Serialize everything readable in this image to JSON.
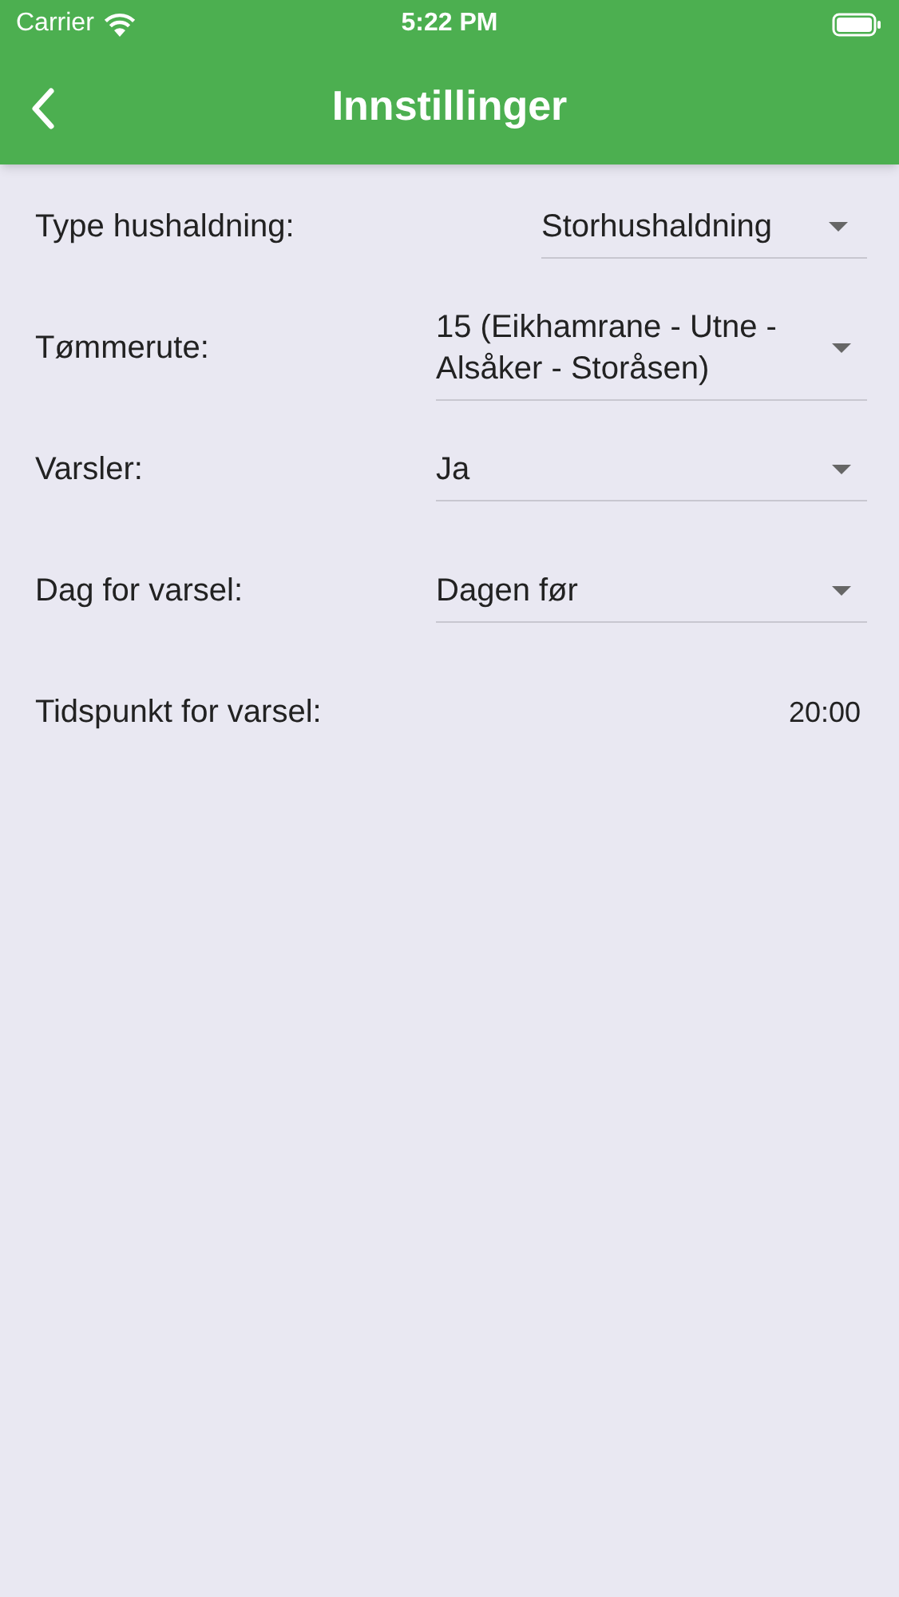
{
  "status_bar": {
    "carrier": "Carrier",
    "time": "5:22 PM"
  },
  "header": {
    "title": "Innstillinger"
  },
  "settings": [
    {
      "kind": "compact_dropdown",
      "label": "Type hushaldning:",
      "value": "Storhushaldning"
    },
    {
      "kind": "dropdown",
      "label": "Tømmerute:",
      "value": "15 (Eikhamrane - Utne - Alsåker - Storåsen)"
    },
    {
      "kind": "dropdown",
      "label": "Varsler:",
      "value": "Ja"
    },
    {
      "kind": "dropdown",
      "label": "Dag for varsel:",
      "value": "Dagen før"
    },
    {
      "kind": "time",
      "label": "Tidspunkt for varsel:",
      "value": "20:00"
    }
  ]
}
